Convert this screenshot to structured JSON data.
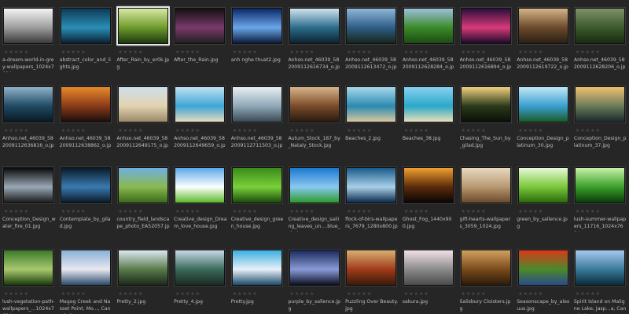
{
  "browser": {
    "rating_glyph": "★",
    "items": [
      {
        "name": "a-dream-world-in-grey-wallpapers_1024x768.jpg",
        "icon": "landscape-photo-icon",
        "colors": [
          "#f4f4f4",
          "#9d9d9d",
          "#3a3a3a"
        ]
      },
      {
        "name": "abstract_color_and_lights.jpg",
        "icon": "landscape-photo-icon",
        "colors": [
          "#0d3a55",
          "#2a8fb5",
          "#0a2033"
        ]
      },
      {
        "name": "After_Rain_by_er0k.jpg",
        "icon": "landscape-photo-icon",
        "colors": [
          "#d9e7a2",
          "#6e9b2c",
          "#1d3a0f"
        ]
      },
      {
        "name": "After_the_Rain.jpg",
        "icon": "landscape-photo-icon",
        "colors": [
          "#111111",
          "#7a3a6a",
          "#202020"
        ]
      },
      {
        "name": "anh nghe thuat2.jpg",
        "icon": "landscape-photo-icon",
        "colors": [
          "#0b2a66",
          "#6aa6ea",
          "#0a1a3a"
        ]
      },
      {
        "name": "Anhso.net_46039_582009112616734_o.jpg",
        "icon": "landscape-photo-icon",
        "colors": [
          "#cfe4ef",
          "#2b6c8a",
          "#0c2230"
        ]
      },
      {
        "name": "Anhso.net_46039_582009112613472_o.jpg",
        "icon": "landscape-photo-icon",
        "colors": [
          "#8fb7d8",
          "#2f5d86",
          "#16261a"
        ]
      },
      {
        "name": "Anhso.net_46039_582009112628284_o.jpg",
        "icon": "landscape-photo-icon",
        "colors": [
          "#9ec0d9",
          "#3a8a2a",
          "#1d4a12"
        ]
      },
      {
        "name": "Anhso.net_46039_582009112616894_o.jpg",
        "icon": "landscape-photo-icon",
        "colors": [
          "#2a0f3a",
          "#d83a7a",
          "#1b0a2a"
        ]
      },
      {
        "name": "Anhso.net_46039_582009112619722_o.jpg",
        "icon": "landscape-photo-icon",
        "colors": [
          "#d6b489",
          "#6a4a2a",
          "#2a1f14"
        ]
      },
      {
        "name": "Anhso.net_46039_582009112628206_o.jpg",
        "icon": "landscape-photo-icon",
        "colors": [
          "#7f8f68",
          "#3b5a2b",
          "#1a2a12"
        ]
      },
      {
        "name": "Anhso.net_46039_582009112636816_o.jpg",
        "icon": "landscape-photo-icon",
        "colors": [
          "#8fb1c8",
          "#1f4a63",
          "#0a1822"
        ]
      },
      {
        "name": "Anhso.net_46039_582009112638862_o.jpg",
        "icon": "landscape-photo-icon",
        "colors": [
          "#e88a2a",
          "#8a3a1a",
          "#1a0f0a"
        ]
      },
      {
        "name": "Anhso.net_46039_582009112649175_o.jpg",
        "icon": "landscape-photo-icon",
        "colors": [
          "#cfe0ea",
          "#e2d2b0",
          "#9a8a6a"
        ]
      },
      {
        "name": "Anhso.net_46039_582009112649659_o.jpg",
        "icon": "landscape-photo-icon",
        "colors": [
          "#bfe2f0",
          "#3da5d6",
          "#e6dcc0"
        ]
      },
      {
        "name": "Anhso.net_46039_582009112711503_o.jpg",
        "icon": "landscape-photo-icon",
        "colors": [
          "#e8eef2",
          "#8fa8b8",
          "#3a4a55"
        ]
      },
      {
        "name": "Autum_Stock_187_by_Nataly_Stock.jpg",
        "icon": "landscape-photo-icon",
        "colors": [
          "#d8b58a",
          "#7a4a2a",
          "#2a1a10"
        ]
      },
      {
        "name": "Beaches_2.jpg",
        "icon": "landscape-photo-icon",
        "colors": [
          "#a8d8ea",
          "#2a8ab0",
          "#d8c8a0"
        ]
      },
      {
        "name": "Beaches_38.jpg",
        "icon": "landscape-photo-icon",
        "colors": [
          "#8ad0f0",
          "#2aa8c8",
          "#e8e0b8"
        ]
      },
      {
        "name": "Chasing_The_Sun_by_gilad.jpg",
        "icon": "landscape-photo-icon",
        "colors": [
          "#f0d080",
          "#2a3a1a",
          "#0a0f08"
        ]
      },
      {
        "name": "Conception_Design_platinum_30.jpg",
        "icon": "landscape-photo-icon",
        "colors": [
          "#bfe8f6",
          "#3a9fd0",
          "#1a5a2a"
        ]
      },
      {
        "name": "Conception_Design_platinum_37.jpg",
        "icon": "landscape-photo-icon",
        "colors": [
          "#f0c070",
          "#6a7a5a",
          "#1a2a2a"
        ]
      },
      {
        "name": "Conception_Design_water_fire_01.jpg",
        "icon": "landscape-photo-icon",
        "colors": [
          "#0a0a0a",
          "#9aa8b5",
          "#1a1a1a"
        ]
      },
      {
        "name": "Contemplate_by_gilad.jpg",
        "icon": "landscape-photo-icon",
        "colors": [
          "#0a1a2a",
          "#3a7ab0",
          "#0a1a2a"
        ]
      },
      {
        "name": "country_field_landscape_photo_EA52057.jpg",
        "icon": "landscape-photo-icon",
        "colors": [
          "#6fb0e0",
          "#8ab850",
          "#3a6a1a"
        ]
      },
      {
        "name": "Creative_design_Dream_love_house.jpg",
        "icon": "landscape-photo-icon",
        "colors": [
          "#5aa8e8",
          "#ffffff",
          "#5ab82a"
        ]
      },
      {
        "name": "Creative_design_green_house.jpg",
        "icon": "landscape-photo-icon",
        "colors": [
          "#3a8a1a",
          "#7ad03a",
          "#1a4a0a"
        ]
      },
      {
        "name": "Creative_design_sailing_leaves_un....blue_sky.jpg",
        "icon": "landscape-photo-icon",
        "colors": [
          "#1a78d0",
          "#8ac8f0",
          "#2a9a2a"
        ]
      },
      {
        "name": "flock-of-birs-wallpapers_7679_1280x800.jpg",
        "icon": "landscape-photo-icon",
        "colors": [
          "#1a5a8a",
          "#a8d0e8",
          "#0a2a4a"
        ]
      },
      {
        "name": "Ghost_Fog_1440x900.jpg",
        "icon": "landscape-photo-icon",
        "colors": [
          "#f0a030",
          "#5a2a0a",
          "#0a0505"
        ]
      },
      {
        "name": "gift-hearts-wallpapers_3059_1024.jpg",
        "icon": "landscape-photo-icon",
        "colors": [
          "#e8d8c0",
          "#b89870",
          "#6a4a2a"
        ]
      },
      {
        "name": "green_by_sallence.jpg",
        "icon": "landscape-photo-icon",
        "colors": [
          "#e8f8d8",
          "#7ac83a",
          "#2a6a0a"
        ]
      },
      {
        "name": "lush-summer-wallpapers_11716_1024x768.jpg",
        "icon": "landscape-photo-icon",
        "colors": [
          "#c8f0a8",
          "#3aa02a",
          "#0a3a0a"
        ]
      },
      {
        "name": "lush-vegetation-path-wallpapers_...1024x768.jpg",
        "icon": "landscape-photo-icon",
        "colors": [
          "#3a7a2a",
          "#a8c870",
          "#1a3a0a"
        ]
      },
      {
        "name": "Magog Creek and Nasset Point, Mo..., Canada.jpg",
        "icon": "landscape-photo-icon",
        "colors": [
          "#8ab0d8",
          "#e8e8f0",
          "#2a4a6a"
        ]
      },
      {
        "name": "Pretty_2.jpg",
        "icon": "landscape-photo-icon",
        "colors": [
          "#dce8f0",
          "#5a7a4a",
          "#1a2a1a"
        ]
      },
      {
        "name": "Pretty_4.jpg",
        "icon": "landscape-photo-icon",
        "colors": [
          "#c8d8e8",
          "#3a6a5a",
          "#1a2a22"
        ]
      },
      {
        "name": "Pretty.jpg",
        "icon": "landscape-photo-icon",
        "colors": [
          "#3ab0e0",
          "#e8f0f8",
          "#1a4a6a"
        ]
      },
      {
        "name": "purple_by_sallence.jpg",
        "icon": "landscape-photo-icon",
        "colors": [
          "#1a2a5a",
          "#8a9ad8",
          "#0a1020"
        ]
      },
      {
        "name": "Puzzling Over Beauty.jpg",
        "icon": "landscape-photo-icon",
        "colors": [
          "#d8b070",
          "#a03a1a",
          "#3a1a0a"
        ]
      },
      {
        "name": "sakura.jpg",
        "icon": "landscape-photo-icon",
        "colors": [
          "#f0e0e8",
          "#8a8a8a",
          "#4a4a4a"
        ]
      },
      {
        "name": "Salisbury Cloisters.jpg",
        "icon": "landscape-photo-icon",
        "colors": [
          "#d0a060",
          "#7a4a1a",
          "#2a1a0a"
        ]
      },
      {
        "name": "Seasonscape_by_alexuus.jpg",
        "icon": "landscape-photo-icon",
        "colors": [
          "#d83a1a",
          "#4a8a2a",
          "#2a4a8a"
        ]
      },
      {
        "name": "Spirit Island on Maligne Lake, Jasp...a, Canada.jpg",
        "icon": "landscape-photo-icon",
        "colors": [
          "#a8c8f0",
          "#3a7a9a",
          "#0a2a3a"
        ]
      }
    ]
  }
}
